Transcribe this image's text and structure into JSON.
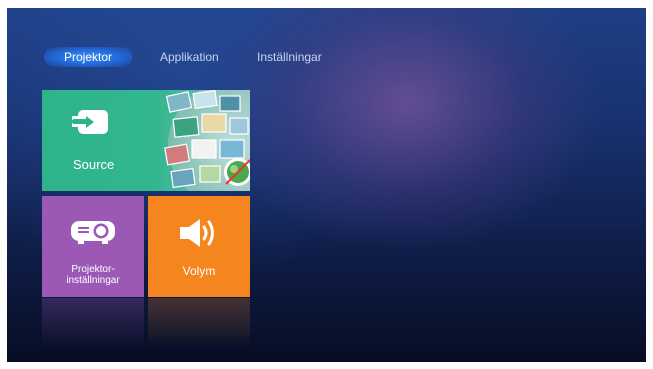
{
  "tabs": [
    {
      "label": "Projektor",
      "active": true
    },
    {
      "label": "Applikation",
      "active": false
    },
    {
      "label": "Inställningar",
      "active": false
    }
  ],
  "tiles": {
    "source": {
      "label": "Source",
      "icon": "input-arrow-icon",
      "color": "#2fb38a"
    },
    "projector_settings": {
      "label": "Projektor-\ninställningar",
      "icon": "projector-icon",
      "color": "#9b59b5"
    },
    "volume": {
      "label": "Volym",
      "icon": "speaker-icon",
      "color": "#f5861f"
    }
  },
  "colors": {
    "active_tab": "#2266d6",
    "background": "#18306d"
  }
}
